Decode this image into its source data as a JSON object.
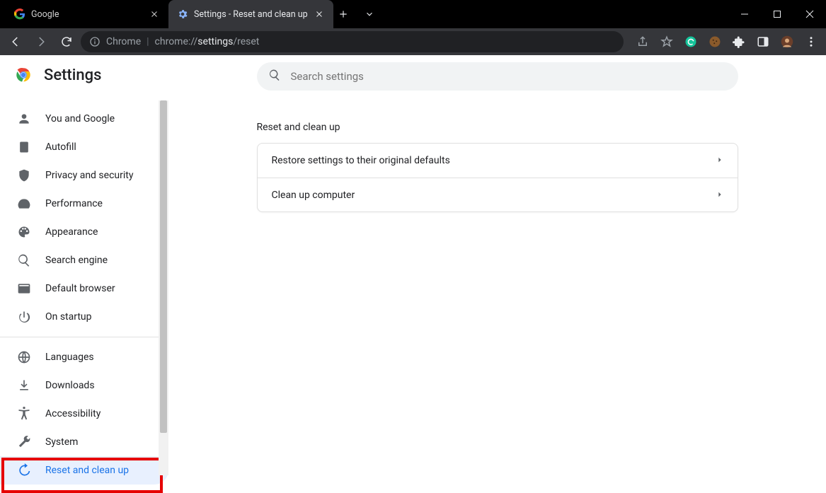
{
  "window": {
    "tabs": [
      {
        "label": "Google",
        "active": false
      },
      {
        "label": "Settings - Reset and clean up",
        "active": true
      }
    ]
  },
  "omnibox": {
    "chrome_label": "Chrome",
    "url_prefix": "chrome://",
    "url_bold": "settings",
    "url_suffix": "/reset"
  },
  "settings": {
    "title": "Settings",
    "search_placeholder": "Search settings",
    "sidebar": {
      "group1": [
        {
          "id": "you-and-google",
          "label": "You and Google",
          "icon": "person"
        },
        {
          "id": "autofill",
          "label": "Autofill",
          "icon": "autofill"
        },
        {
          "id": "privacy",
          "label": "Privacy and security",
          "icon": "shield"
        },
        {
          "id": "performance",
          "label": "Performance",
          "icon": "speed"
        },
        {
          "id": "appearance",
          "label": "Appearance",
          "icon": "palette"
        },
        {
          "id": "search-engine",
          "label": "Search engine",
          "icon": "search"
        },
        {
          "id": "default-browser",
          "label": "Default browser",
          "icon": "browser"
        },
        {
          "id": "on-startup",
          "label": "On startup",
          "icon": "power"
        }
      ],
      "group2": [
        {
          "id": "languages",
          "label": "Languages",
          "icon": "globe"
        },
        {
          "id": "downloads",
          "label": "Downloads",
          "icon": "download"
        },
        {
          "id": "accessibility",
          "label": "Accessibility",
          "icon": "accessibility"
        },
        {
          "id": "system",
          "label": "System",
          "icon": "wrench"
        },
        {
          "id": "reset",
          "label": "Reset and clean up",
          "icon": "restore",
          "selected": true
        }
      ]
    },
    "section_title": "Reset and clean up",
    "rows": [
      {
        "id": "restore-defaults",
        "label": "Restore settings to their original defaults"
      },
      {
        "id": "cleanup",
        "label": "Clean up computer"
      }
    ]
  }
}
